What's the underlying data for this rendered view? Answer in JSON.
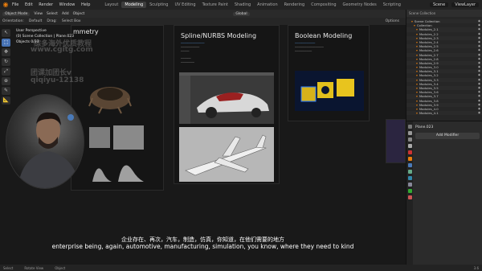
{
  "menubar": {
    "items": [
      "File",
      "Edit",
      "Render",
      "Window",
      "Help"
    ],
    "tabs": [
      "Layout",
      "Modeling",
      "Sculpting",
      "UV Editing",
      "Texture Paint",
      "Shading",
      "Animation",
      "Rendering",
      "Compositing",
      "Geometry Nodes",
      "Scripting"
    ],
    "active_tab": "Modeling",
    "scene": "Scene",
    "view_layer": "ViewLayer"
  },
  "header": {
    "mode": "Object Mode",
    "view": "View",
    "select": "Select",
    "add": "Add",
    "object": "Object",
    "transform": "Global"
  },
  "subheader": {
    "orientation": "Orientation:",
    "orientation_value": "Default",
    "drag": "Drag:",
    "drag_value": "Select Box",
    "options": "Options"
  },
  "viewport_info": {
    "line1": "User Perspective",
    "line2": "(0) Scene Collection | Plane.023",
    "line3": "Objects   0/33"
  },
  "watermarks": {
    "cn1": "综多海外优质教程",
    "url": "www.cgitg.com",
    "team": "团课加团长v",
    "qq": "qiqiyu-12138"
  },
  "panels": {
    "symmetry_title": "mmetry",
    "spline_title": "Spline/NURBS Modeling",
    "boolean_title": "Boolean Modeling"
  },
  "subtitles": {
    "cn": "企业存在、再次，汽车，制造，仿真，你知道，在他们需要的地方",
    "en": "enterprise being, again, automotive, manufacturing, simulation, you know, where they need to kind"
  },
  "status": {
    "select": "Select",
    "rotate": "Rotate View",
    "object": "Object",
    "version": "3.6"
  },
  "outliner": {
    "header": "Scene Collection",
    "items": [
      "Scene Collection",
      "Collection",
      "Modules_2.1",
      "Modules_2.2",
      "Modules_2.3",
      "Modules_2.4",
      "Modules_2.5",
      "Modules_2.6",
      "Modules_2.7",
      "Modules_2.8",
      "Modules_2.9",
      "Modules_3.0",
      "Modules_3.1",
      "Modules_3.2",
      "Modules_3.3",
      "Modules_3.4",
      "Modules_3.5",
      "Modules_3.6",
      "Modules_3.7",
      "Modules_3.8",
      "Modules_3.9",
      "Modules_4.0",
      "Modules_4.1"
    ]
  },
  "properties": {
    "object_name": "Plane.023",
    "add_modifier": "Add Modifier"
  },
  "colors": {
    "accent": "#e87d0d",
    "active_tool": "#4772b3"
  }
}
